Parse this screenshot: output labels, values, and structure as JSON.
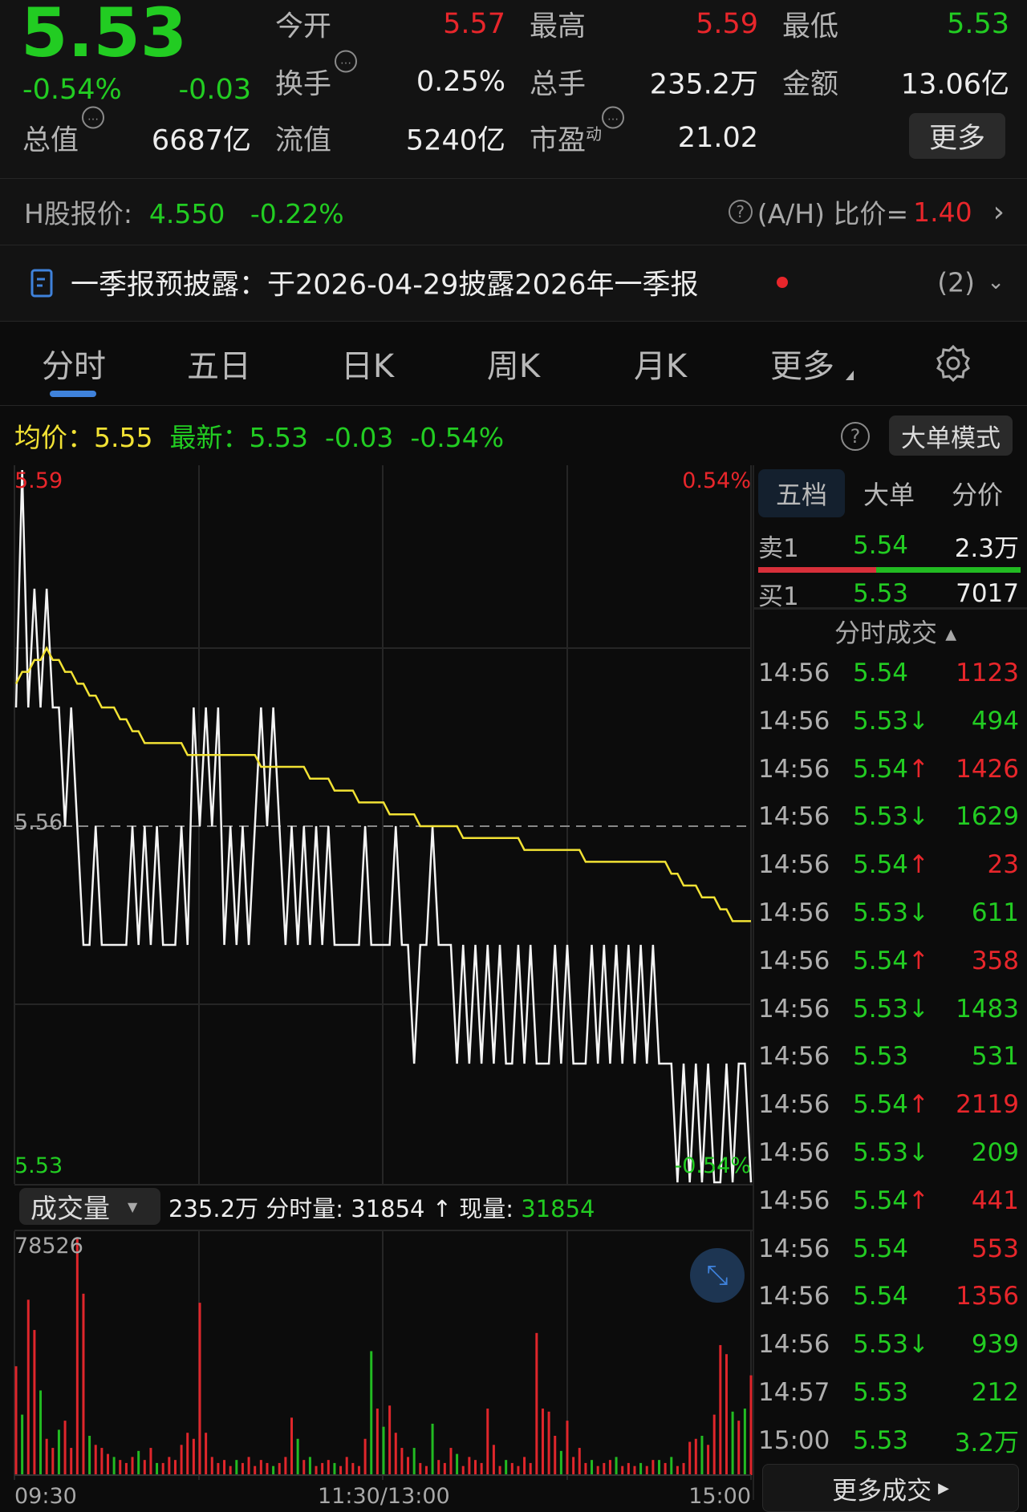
{
  "quote": {
    "price": "5.53",
    "change_pct": "-0.54%",
    "change": "-0.03",
    "open_label": "今开",
    "open": "5.57",
    "high_label": "最高",
    "high": "5.59",
    "low_label": "最低",
    "low": "5.53",
    "turnover_label": "换手",
    "turnover": "0.25%",
    "volume_label": "总手",
    "volume": "235.2万",
    "amount_label": "金额",
    "amount": "13.06亿",
    "mktcap_label": "总值",
    "mktcap": "6687亿",
    "float_label": "流值",
    "float_cap": "5240亿",
    "pe_label": "市盈",
    "pe_sup": "动",
    "pe": "21.02",
    "more_label": "更多",
    "info_icon": "…"
  },
  "hshare": {
    "label": "H股报价:",
    "price": "4.550",
    "change_pct": "-0.22%",
    "ah_label": "(A/H) 比价=",
    "ah_value": "1.40",
    "help": "?"
  },
  "notice": {
    "text": "一季报预披露：于2026-04-29披露2026年一季报",
    "count": "(2)"
  },
  "tabs": [
    {
      "label": "分时"
    },
    {
      "label": "五日"
    },
    {
      "label": "日K"
    },
    {
      "label": "周K"
    },
    {
      "label": "月K"
    },
    {
      "label": "更多"
    }
  ],
  "info": {
    "avg_label": "均价：5.55",
    "latest_label": "最新：5.53",
    "change": "-0.03",
    "change_pct": "-0.54%",
    "help": "?",
    "bigorder_label": "大单模式"
  },
  "chart_data": {
    "type": "line",
    "ylim": [
      5.53,
      5.59
    ],
    "prev_close": 5.56,
    "y_labels": {
      "top": "5.59",
      "mid": "5.56",
      "bottom": "5.53",
      "top_pct": "0.54%",
      "bottom_pct": "-0.54%"
    },
    "x_labels": [
      "09:30",
      "11:30/13:00",
      "15:00"
    ],
    "price": [
      5.57,
      5.59,
      5.57,
      5.58,
      5.57,
      5.58,
      5.57,
      5.57,
      5.56,
      5.57,
      5.56,
      5.55,
      5.55,
      5.56,
      5.55,
      5.55,
      5.55,
      5.55,
      5.55,
      5.56,
      5.55,
      5.56,
      5.55,
      5.56,
      5.55,
      5.55,
      5.55,
      5.56,
      5.55,
      5.57,
      5.56,
      5.57,
      5.56,
      5.57,
      5.55,
      5.56,
      5.55,
      5.56,
      5.55,
      5.56,
      5.57,
      5.56,
      5.57,
      5.56,
      5.55,
      5.56,
      5.55,
      5.56,
      5.55,
      5.56,
      5.55,
      5.56,
      5.55,
      5.55,
      5.55,
      5.55,
      5.55,
      5.56,
      5.55,
      5.55,
      5.55,
      5.55,
      5.56,
      5.55,
      5.55,
      5.54,
      5.55,
      5.55,
      5.56,
      5.55,
      5.55,
      5.55,
      5.54,
      5.55,
      5.54,
      5.55,
      5.54,
      5.55,
      5.54,
      5.55,
      5.54,
      5.54,
      5.55,
      5.54,
      5.55,
      5.54,
      5.54,
      5.54,
      5.55,
      5.54,
      5.55,
      5.54,
      5.54,
      5.54,
      5.55,
      5.54,
      5.55,
      5.54,
      5.55,
      5.54,
      5.55,
      5.54,
      5.55,
      5.54,
      5.55,
      5.54,
      5.54,
      5.54,
      5.53,
      5.54,
      5.53,
      5.54,
      5.53,
      5.54,
      5.53,
      5.53,
      5.54,
      5.53,
      5.54,
      5.54,
      5.53
    ],
    "avg_keypoints": [
      [
        0,
        5.572
      ],
      [
        5,
        5.575
      ],
      [
        10,
        5.572
      ],
      [
        22,
        5.567
      ],
      [
        45,
        5.565
      ],
      [
        60,
        5.5615
      ],
      [
        68,
        5.56
      ],
      [
        92,
        5.5575
      ],
      [
        106,
        5.5565
      ],
      [
        118,
        5.552
      ]
    ],
    "volume_max": "78526",
    "volume": [
      36000,
      -20000,
      58000,
      48000,
      -28000,
      12000,
      9000,
      -15000,
      18000,
      9000,
      78526,
      60000,
      -13000,
      10000,
      9000,
      7000,
      -6000,
      5000,
      4000,
      6000,
      -8000,
      5000,
      9000,
      -4000,
      4000,
      6000,
      5000,
      10000,
      14000,
      12000,
      57000,
      14000,
      6000,
      4000,
      5000,
      3000,
      -5000,
      4000,
      6000,
      3000,
      5000,
      4000,
      -3000,
      4000,
      6000,
      19000,
      -12000,
      5000,
      -6000,
      3000,
      4000,
      5000,
      -4000,
      3000,
      6000,
      4000,
      3000,
      12000,
      -41000,
      22000,
      -16000,
      23000,
      14000,
      9000,
      6000,
      -9000,
      4000,
      3000,
      -17000,
      5000,
      4000,
      9000,
      -7000,
      3000,
      6000,
      5000,
      4000,
      22000,
      10000,
      3000,
      -5000,
      4000,
      3000,
      6000,
      4000,
      47000,
      22000,
      21000,
      13000,
      -8000,
      18000,
      6000,
      9000,
      4000,
      -5000,
      3000,
      4000,
      5000,
      -6000,
      3000,
      4000,
      3000,
      -4000,
      3000,
      5000,
      -5000,
      4000,
      -6000,
      3000,
      4000,
      11000,
      12000,
      -13000,
      10000,
      20000,
      43000,
      40000,
      -21000,
      18000,
      -22000,
      33000
    ]
  },
  "volume_header": {
    "select": "成交量",
    "total": "235.2万",
    "minute_label": "分时量: 31854 ↑",
    "now_label": "现量:",
    "now": "31854"
  },
  "book": {
    "tabs": [
      "五档",
      "大单",
      "分价"
    ],
    "sell_label": "卖1",
    "sell_price": "5.54",
    "sell_vol": "2.3万",
    "buy_label": "买1",
    "buy_price": "5.53",
    "buy_vol": "7017",
    "buy_ratio": 0.45,
    "trades_title": "分时成交",
    "more_trades": "更多成交"
  },
  "trades": [
    {
      "time": "14:56",
      "price": "5.54",
      "arrow": "",
      "vol": "1123",
      "side": "r"
    },
    {
      "time": "14:56",
      "price": "5.53",
      "arrow": "↓",
      "vol": "494",
      "side": "g"
    },
    {
      "time": "14:56",
      "price": "5.54",
      "arrow": "↑",
      "vol": "1426",
      "side": "r"
    },
    {
      "time": "14:56",
      "price": "5.53",
      "arrow": "↓",
      "vol": "1629",
      "side": "g"
    },
    {
      "time": "14:56",
      "price": "5.54",
      "arrow": "↑",
      "vol": "23",
      "side": "r"
    },
    {
      "time": "14:56",
      "price": "5.53",
      "arrow": "↓",
      "vol": "611",
      "side": "g"
    },
    {
      "time": "14:56",
      "price": "5.54",
      "arrow": "↑",
      "vol": "358",
      "side": "r"
    },
    {
      "time": "14:56",
      "price": "5.53",
      "arrow": "↓",
      "vol": "1483",
      "side": "g"
    },
    {
      "time": "14:56",
      "price": "5.53",
      "arrow": "",
      "vol": "531",
      "side": "g"
    },
    {
      "time": "14:56",
      "price": "5.54",
      "arrow": "↑",
      "vol": "2119",
      "side": "r"
    },
    {
      "time": "14:56",
      "price": "5.53",
      "arrow": "↓",
      "vol": "209",
      "side": "g"
    },
    {
      "time": "14:56",
      "price": "5.54",
      "arrow": "↑",
      "vol": "441",
      "side": "r"
    },
    {
      "time": "14:56",
      "price": "5.54",
      "arrow": "",
      "vol": "553",
      "side": "r"
    },
    {
      "time": "14:56",
      "price": "5.54",
      "arrow": "",
      "vol": "1356",
      "side": "r"
    },
    {
      "time": "14:56",
      "price": "5.53",
      "arrow": "↓",
      "vol": "939",
      "side": "g"
    },
    {
      "time": "14:57",
      "price": "5.53",
      "arrow": "",
      "vol": "212",
      "side": "g"
    },
    {
      "time": "15:00",
      "price": "5.53",
      "arrow": "",
      "vol": "3.2万",
      "side": "g"
    }
  ]
}
